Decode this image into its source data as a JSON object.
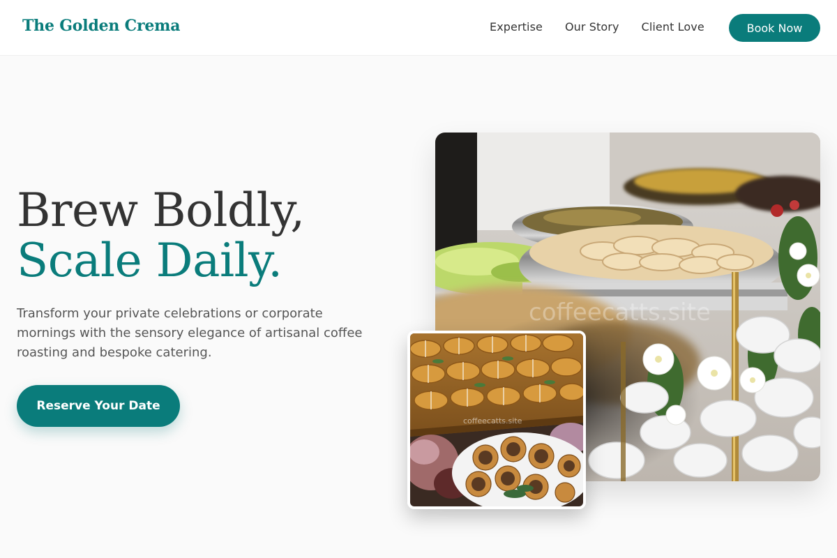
{
  "brand": {
    "name": "The Golden Crema",
    "accent_color": "#0a7c7b",
    "text_color": "#333333"
  },
  "nav": {
    "links": [
      "Expertise",
      "Our Story",
      "Client Love"
    ],
    "cta": "Book Now"
  },
  "hero": {
    "title_line1": "Brew Boldly,",
    "title_line2": "Scale Daily.",
    "subtitle": "Transform your private celebrations or corporate mornings with the sensory elegance of artisanal coffee roasting and bespoke catering.",
    "cta": "Reserve Your Date"
  },
  "images": {
    "main_watermark": "coffeecatts.site",
    "sub_watermark": "coffeecatts.site"
  }
}
